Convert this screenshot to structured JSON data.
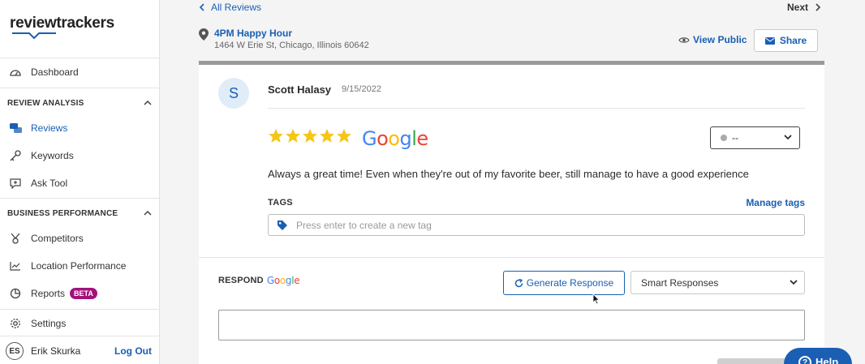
{
  "brand": {
    "logo_text": "reviewtrackers"
  },
  "sidebar": {
    "dashboard": "Dashboard",
    "section_review": "REVIEW ANALYSIS",
    "reviews": "Reviews",
    "keywords": "Keywords",
    "ask_tool": "Ask Tool",
    "section_business": "BUSINESS PERFORMANCE",
    "competitors": "Competitors",
    "location_performance": "Location Performance",
    "reports": "Reports",
    "reports_badge": "BETA",
    "settings": "Settings",
    "user_initials": "ES",
    "user_name": "Erik Skurka",
    "logout": "Log Out"
  },
  "topbar": {
    "back": "All Reviews",
    "next": "Next"
  },
  "location": {
    "name": "4PM Happy Hour",
    "address": "1464 W Erie St, Chicago, Illinois 60642"
  },
  "actions": {
    "view_public": "View Public",
    "share": "Share"
  },
  "review": {
    "avatar_initial": "S",
    "author": "Scott Halasy",
    "date": "9/15/2022",
    "rating": 5,
    "rating_max": 5,
    "source": "Google",
    "status_value": "--",
    "text": "Always a great time! Even when they're out of my favorite beer, still manage to have a good experience"
  },
  "tags": {
    "label": "TAGS",
    "manage": "Manage tags",
    "placeholder": "Press enter to create a new tag"
  },
  "respond": {
    "label": "RESPOND",
    "source": "Google",
    "generate": "Generate Response",
    "smart_responses": "Smart Responses"
  },
  "help": {
    "label": "Help"
  },
  "colors": {
    "accent": "#1a5fb4",
    "star": "#f5c518",
    "beta": "#a3127a"
  }
}
